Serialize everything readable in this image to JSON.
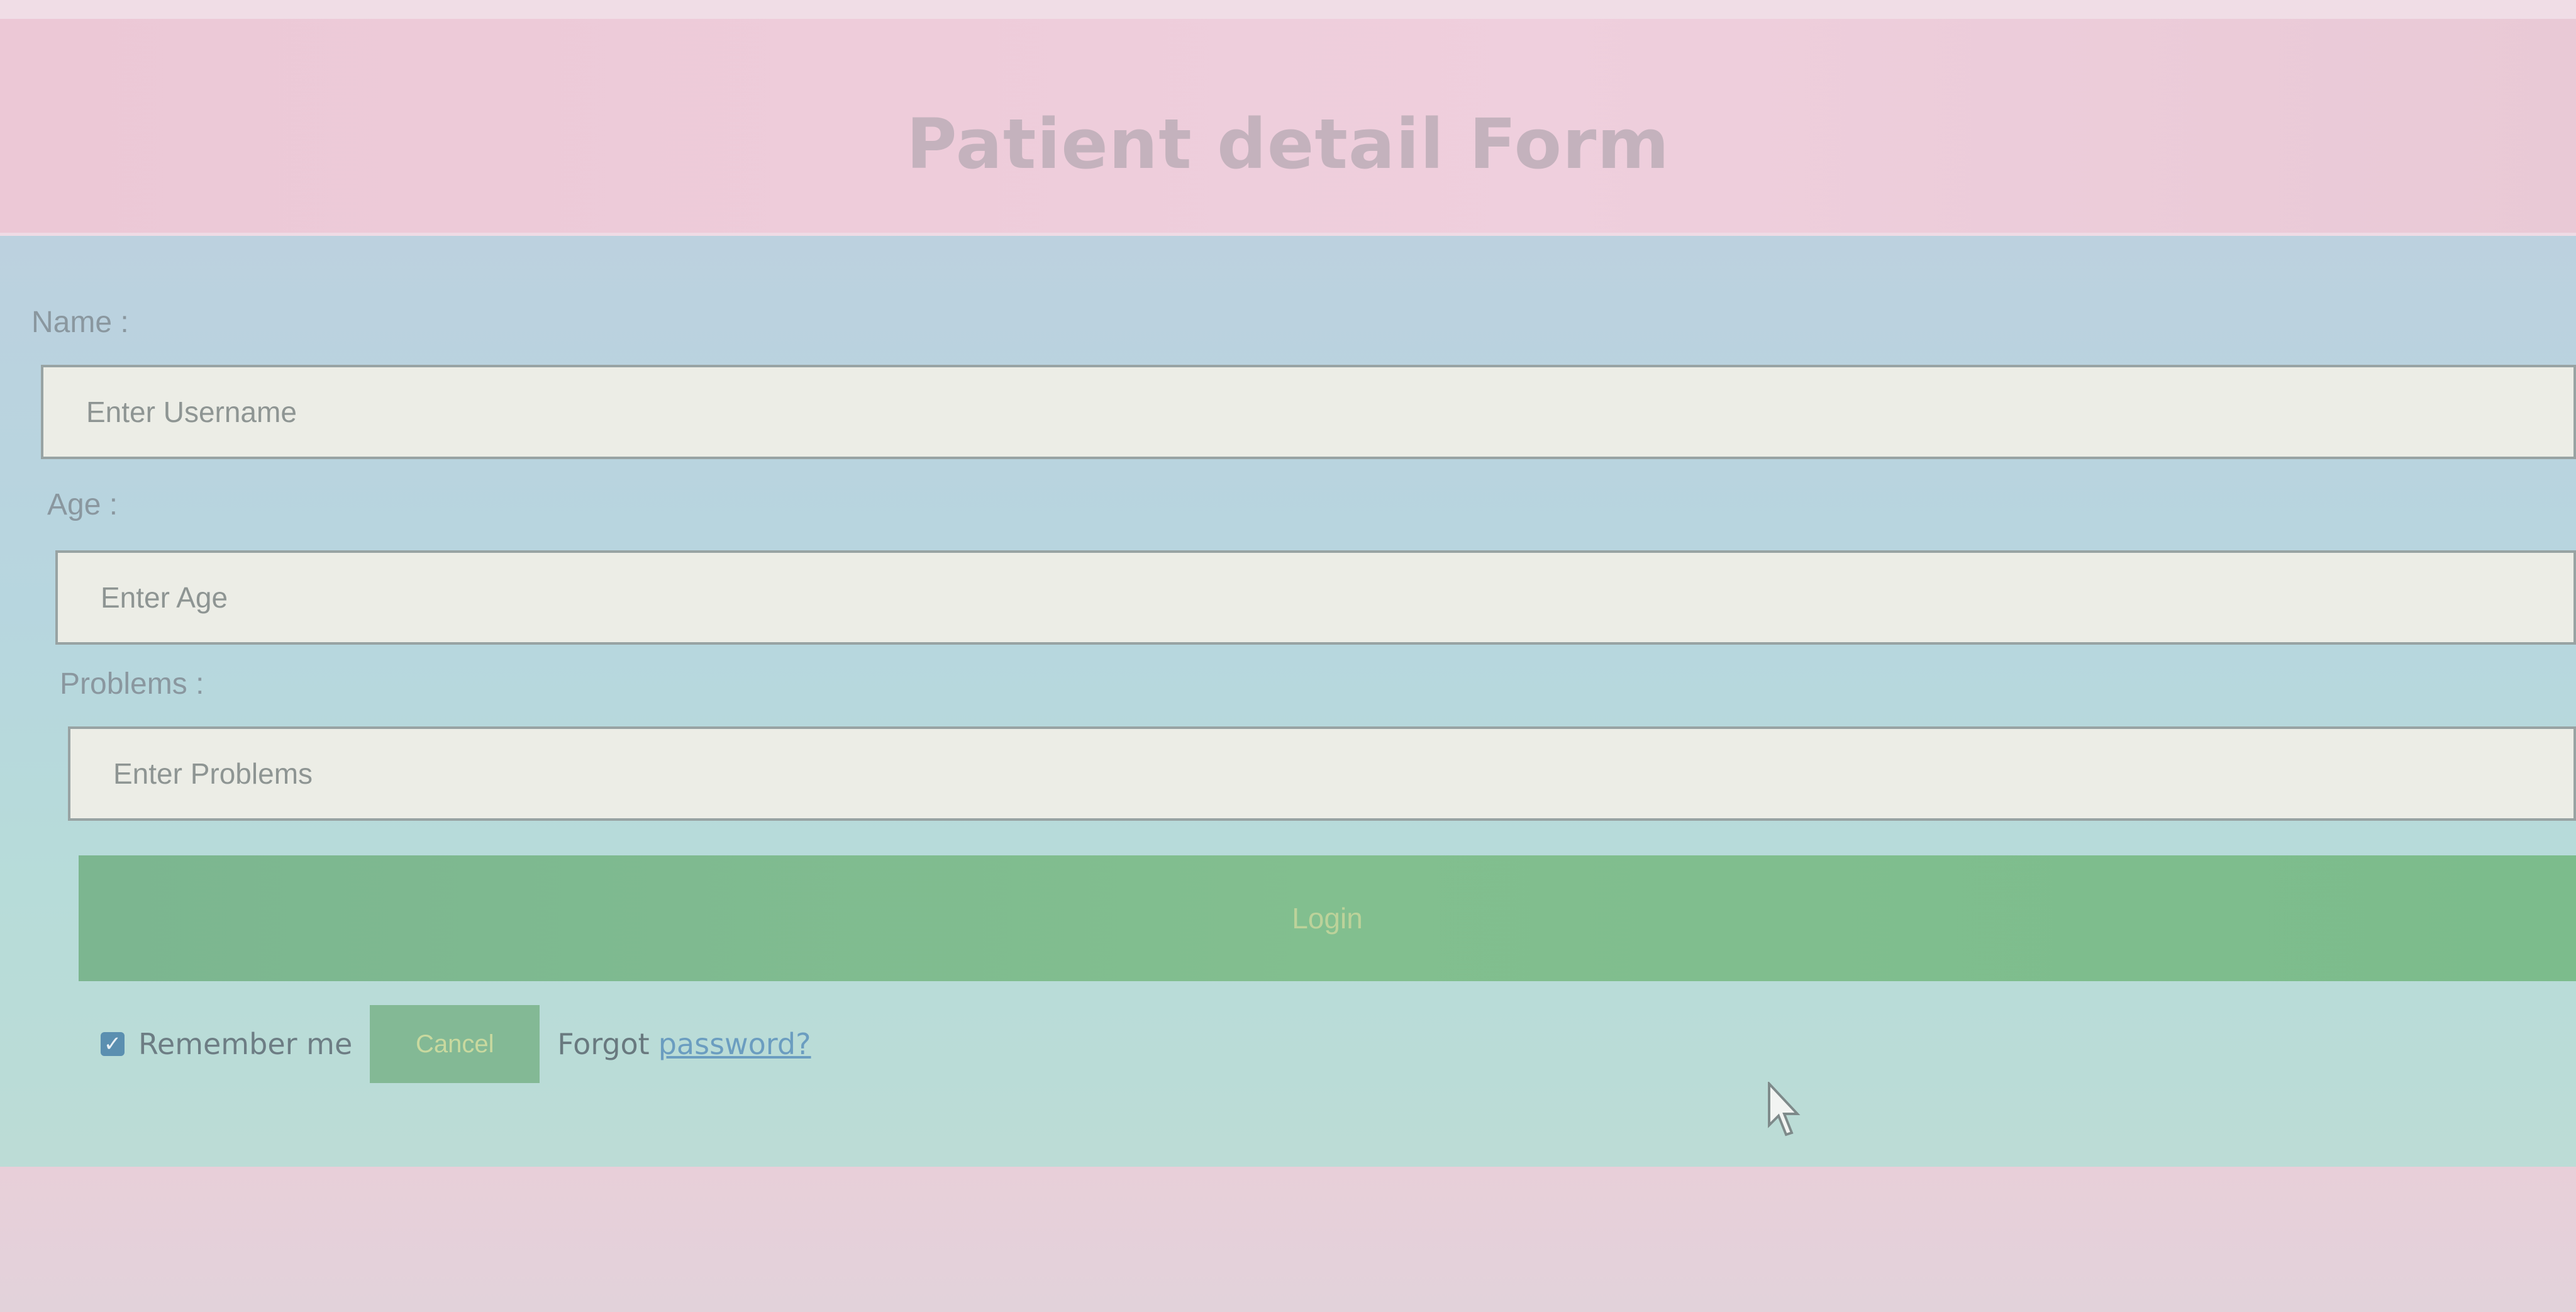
{
  "header": {
    "title": "Patient detail Form"
  },
  "form": {
    "name_label": "Name :",
    "name_placeholder": "Enter Username",
    "age_label": "Age :",
    "age_placeholder": "Enter Age",
    "problems_label": "Problems :",
    "problems_placeholder": "Enter Problems",
    "login_label": "Login",
    "remember_label": "Remember me",
    "remember_checked": true,
    "cancel_label": "Cancel",
    "forgot_text": "Forgot",
    "forgot_link": "password?"
  },
  "colors": {
    "header_bg": "#ecc8d6",
    "form_bg": "#b7d6df",
    "button_green": "#7cb690",
    "link_blue": "#6b9dc0"
  },
  "icons": {
    "checkbox": "checkbox-checked-icon",
    "cursor": "mouse-pointer-icon"
  }
}
